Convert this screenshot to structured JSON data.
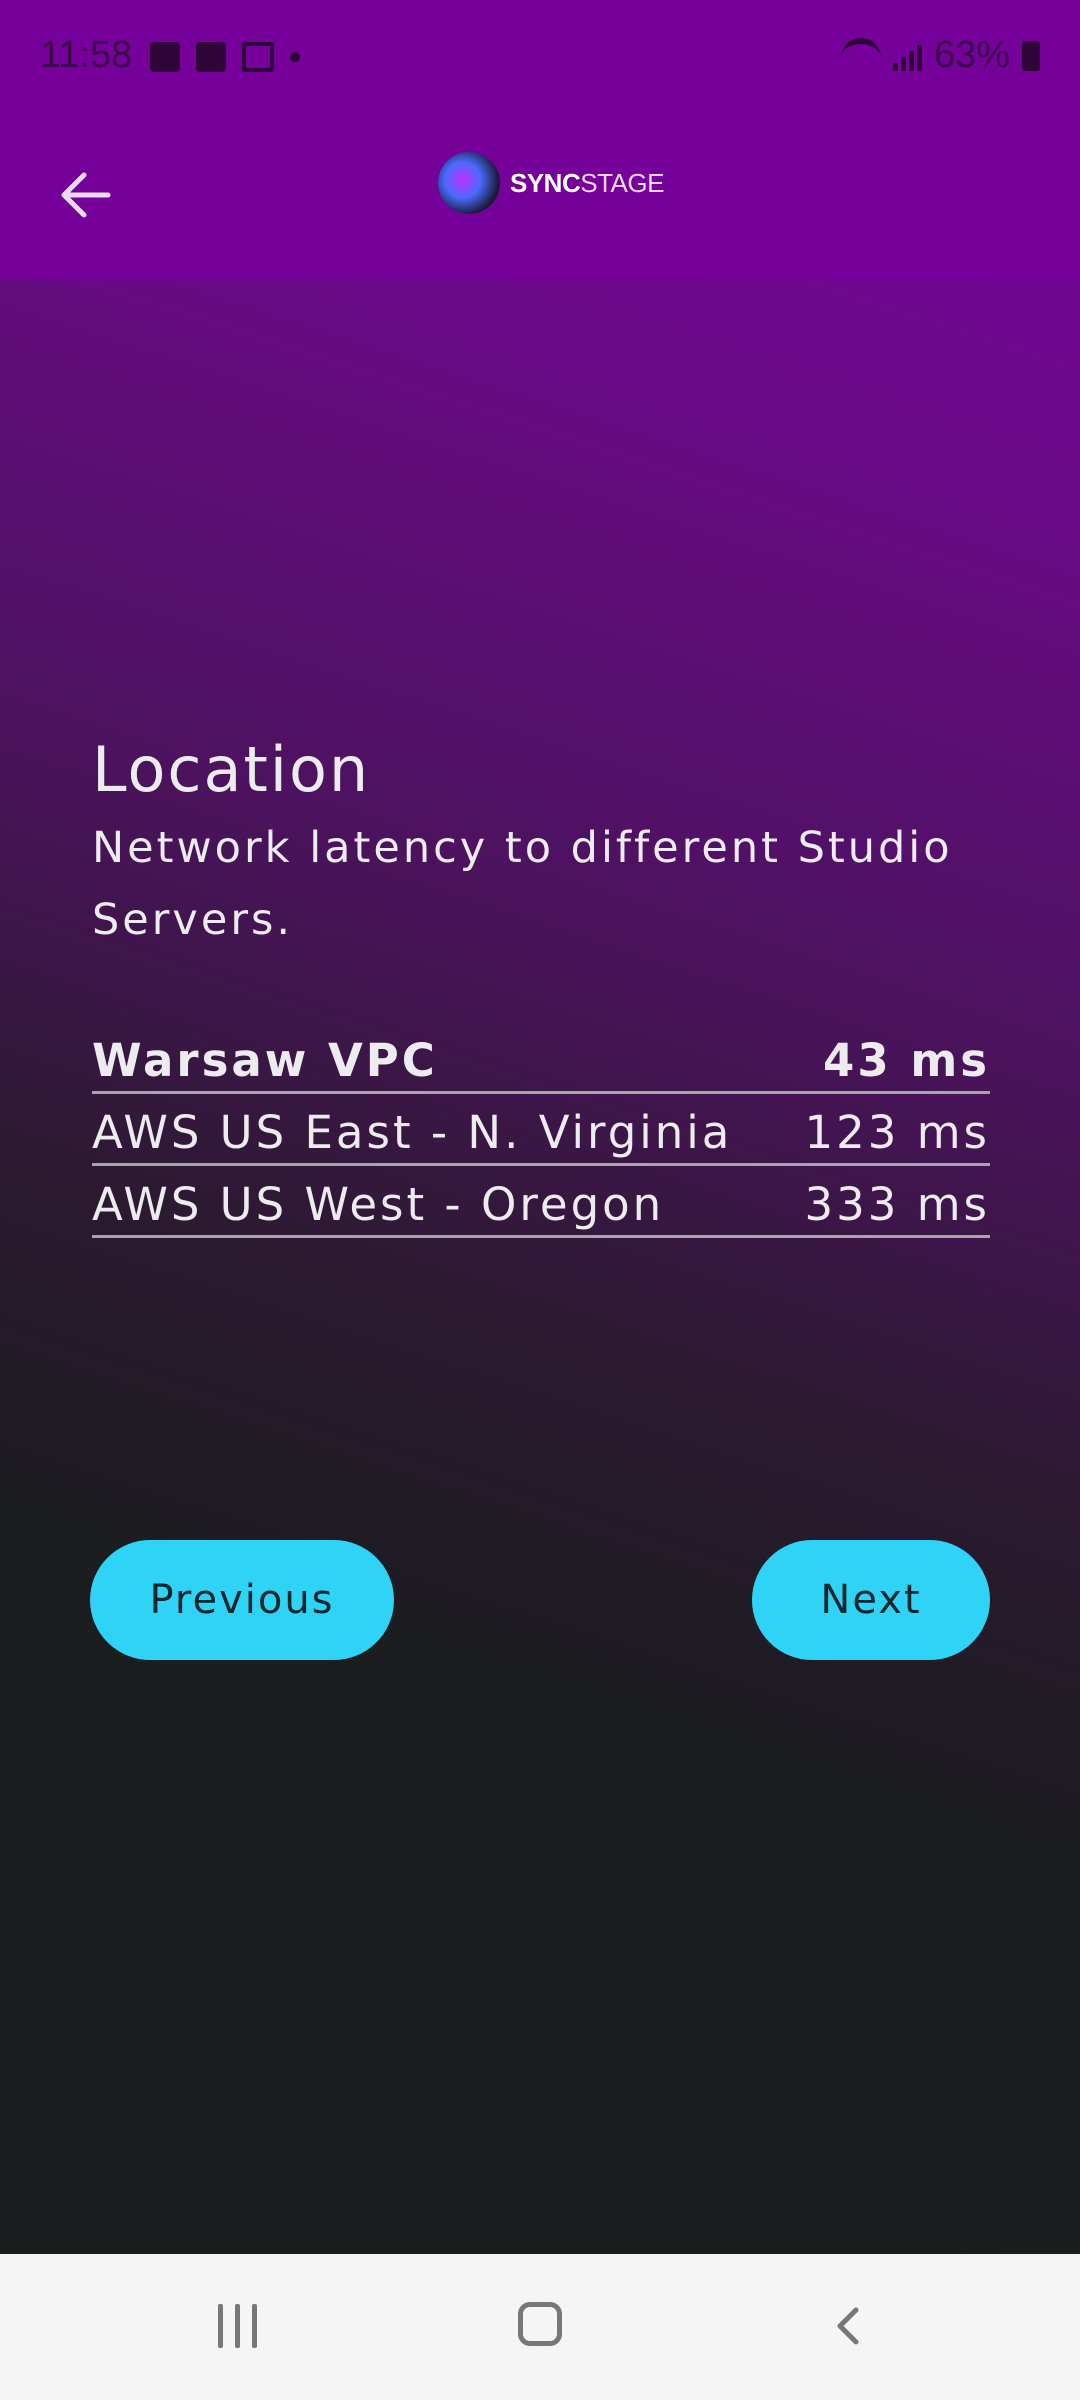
{
  "status_bar": {
    "time": "11:58",
    "battery": "63%"
  },
  "app_bar": {
    "logo_bold": "SYNC",
    "logo_light": "STAGE"
  },
  "location": {
    "title": "Location",
    "subtitle": "Network latency to different Studio Servers."
  },
  "servers": [
    {
      "name": "Warsaw VPC",
      "latency": "43 ms",
      "selected": true
    },
    {
      "name": "AWS US East - N. Virginia",
      "latency": "123 ms",
      "selected": false
    },
    {
      "name": "AWS US West - Oregon",
      "latency": "333 ms",
      "selected": false
    }
  ],
  "buttons": {
    "previous": "Previous",
    "next": "Next"
  },
  "icons": {
    "back": "arrow-left-icon",
    "logo": "syncstage-logo",
    "nav_recents": "recents-icon",
    "nav_home": "home-icon",
    "nav_back": "chevron-left-icon"
  },
  "colors": {
    "header": "#75009a",
    "accent_button": "#2ed3f6",
    "background_dark": "#1a1d1e"
  }
}
